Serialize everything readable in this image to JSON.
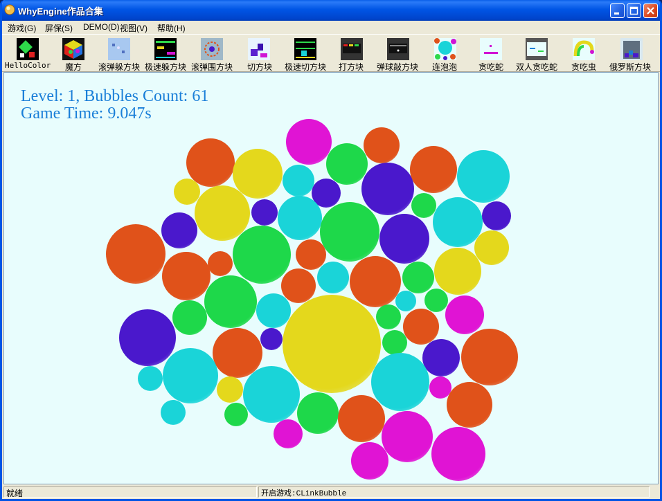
{
  "window": {
    "title": "WhyEngine作品合集"
  },
  "menu": [
    {
      "label": "游戏(G)"
    },
    {
      "label": "屏保(S)"
    },
    {
      "label": "DEMO(D)"
    },
    {
      "label": "视图(V)"
    },
    {
      "label": "帮助(H)"
    }
  ],
  "toolbar": [
    {
      "label": "HelloColor",
      "icon": "hellocolor-icon"
    },
    {
      "label": "魔方",
      "icon": "rubiks-cube-icon"
    },
    {
      "label": "滚弹躲方块",
      "icon": "dodge-blocks-icon"
    },
    {
      "label": "极速躲方块",
      "icon": "speed-dodge-icon"
    },
    {
      "label": "滚弹围方块",
      "icon": "surround-blocks-icon"
    },
    {
      "label": "切方块",
      "icon": "cut-blocks-icon"
    },
    {
      "label": "极速切方块",
      "icon": "speed-cut-icon"
    },
    {
      "label": "打方块",
      "icon": "hit-blocks-icon"
    },
    {
      "label": "弹球敲方块",
      "icon": "pinball-blocks-icon"
    },
    {
      "label": "连泡泡",
      "icon": "link-bubble-icon"
    },
    {
      "label": "贪吃蛇",
      "icon": "snake-icon"
    },
    {
      "label": "双人贪吃蛇",
      "icon": "two-player-snake-icon"
    },
    {
      "label": "贪吃虫",
      "icon": "worm-icon"
    },
    {
      "label": "俄罗斯方块",
      "icon": "tetris-icon"
    }
  ],
  "game": {
    "level_line": "Level: 1, Bubbles Count: 61",
    "time_line": "Game Time: 9.047s",
    "colors": {
      "orange": "#e0521a",
      "yellow": "#e4d81c",
      "green": "#1ed84a",
      "cyan": "#1ad4d8",
      "blue": "#4a18cc",
      "magenta": "#e014d4",
      "background": "#e8fdfd",
      "hud_text": "#1a7fd8"
    }
  },
  "status": {
    "left": "就绪",
    "right": "开启游戏:CLinkBubble"
  }
}
